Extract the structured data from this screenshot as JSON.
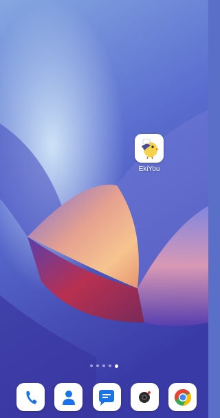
{
  "home_screen": {
    "apps": [
      {
        "label": "EkiYou",
        "icon": "ekiyou-bird-icon"
      }
    ],
    "pagination": {
      "total": 5,
      "current": 5
    },
    "dock": [
      {
        "app": "phone",
        "icon": "phone-icon"
      },
      {
        "app": "contacts",
        "icon": "contacts-icon"
      },
      {
        "app": "messages",
        "icon": "messages-icon"
      },
      {
        "app": "camera",
        "icon": "camera-icon"
      },
      {
        "app": "chrome",
        "icon": "chrome-icon"
      }
    ]
  },
  "colors": {
    "wallpaper_top": "#6c8fd9",
    "wallpaper_bottom": "#3c3aa8",
    "wallpaper_peach": "#f0b08e",
    "wallpaper_red": "#c03040",
    "dock_blue": "#1a73e8"
  }
}
